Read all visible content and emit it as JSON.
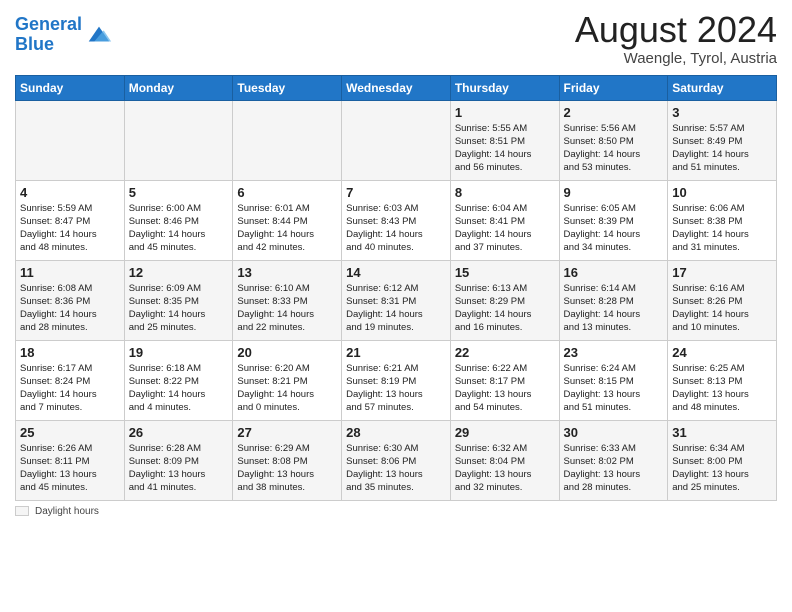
{
  "header": {
    "logo_line1": "General",
    "logo_line2": "Blue",
    "month_title": "August 2024",
    "location": "Waengle, Tyrol, Austria"
  },
  "legend": {
    "label": "Daylight hours"
  },
  "days_of_week": [
    "Sunday",
    "Monday",
    "Tuesday",
    "Wednesday",
    "Thursday",
    "Friday",
    "Saturday"
  ],
  "weeks": [
    [
      {
        "day": "",
        "info": ""
      },
      {
        "day": "",
        "info": ""
      },
      {
        "day": "",
        "info": ""
      },
      {
        "day": "",
        "info": ""
      },
      {
        "day": "1",
        "info": "Sunrise: 5:55 AM\nSunset: 8:51 PM\nDaylight: 14 hours\nand 56 minutes."
      },
      {
        "day": "2",
        "info": "Sunrise: 5:56 AM\nSunset: 8:50 PM\nDaylight: 14 hours\nand 53 minutes."
      },
      {
        "day": "3",
        "info": "Sunrise: 5:57 AM\nSunset: 8:49 PM\nDaylight: 14 hours\nand 51 minutes."
      }
    ],
    [
      {
        "day": "4",
        "info": "Sunrise: 5:59 AM\nSunset: 8:47 PM\nDaylight: 14 hours\nand 48 minutes."
      },
      {
        "day": "5",
        "info": "Sunrise: 6:00 AM\nSunset: 8:46 PM\nDaylight: 14 hours\nand 45 minutes."
      },
      {
        "day": "6",
        "info": "Sunrise: 6:01 AM\nSunset: 8:44 PM\nDaylight: 14 hours\nand 42 minutes."
      },
      {
        "day": "7",
        "info": "Sunrise: 6:03 AM\nSunset: 8:43 PM\nDaylight: 14 hours\nand 40 minutes."
      },
      {
        "day": "8",
        "info": "Sunrise: 6:04 AM\nSunset: 8:41 PM\nDaylight: 14 hours\nand 37 minutes."
      },
      {
        "day": "9",
        "info": "Sunrise: 6:05 AM\nSunset: 8:39 PM\nDaylight: 14 hours\nand 34 minutes."
      },
      {
        "day": "10",
        "info": "Sunrise: 6:06 AM\nSunset: 8:38 PM\nDaylight: 14 hours\nand 31 minutes."
      }
    ],
    [
      {
        "day": "11",
        "info": "Sunrise: 6:08 AM\nSunset: 8:36 PM\nDaylight: 14 hours\nand 28 minutes."
      },
      {
        "day": "12",
        "info": "Sunrise: 6:09 AM\nSunset: 8:35 PM\nDaylight: 14 hours\nand 25 minutes."
      },
      {
        "day": "13",
        "info": "Sunrise: 6:10 AM\nSunset: 8:33 PM\nDaylight: 14 hours\nand 22 minutes."
      },
      {
        "day": "14",
        "info": "Sunrise: 6:12 AM\nSunset: 8:31 PM\nDaylight: 14 hours\nand 19 minutes."
      },
      {
        "day": "15",
        "info": "Sunrise: 6:13 AM\nSunset: 8:29 PM\nDaylight: 14 hours\nand 16 minutes."
      },
      {
        "day": "16",
        "info": "Sunrise: 6:14 AM\nSunset: 8:28 PM\nDaylight: 14 hours\nand 13 minutes."
      },
      {
        "day": "17",
        "info": "Sunrise: 6:16 AM\nSunset: 8:26 PM\nDaylight: 14 hours\nand 10 minutes."
      }
    ],
    [
      {
        "day": "18",
        "info": "Sunrise: 6:17 AM\nSunset: 8:24 PM\nDaylight: 14 hours\nand 7 minutes."
      },
      {
        "day": "19",
        "info": "Sunrise: 6:18 AM\nSunset: 8:22 PM\nDaylight: 14 hours\nand 4 minutes."
      },
      {
        "day": "20",
        "info": "Sunrise: 6:20 AM\nSunset: 8:21 PM\nDaylight: 14 hours\nand 0 minutes."
      },
      {
        "day": "21",
        "info": "Sunrise: 6:21 AM\nSunset: 8:19 PM\nDaylight: 13 hours\nand 57 minutes."
      },
      {
        "day": "22",
        "info": "Sunrise: 6:22 AM\nSunset: 8:17 PM\nDaylight: 13 hours\nand 54 minutes."
      },
      {
        "day": "23",
        "info": "Sunrise: 6:24 AM\nSunset: 8:15 PM\nDaylight: 13 hours\nand 51 minutes."
      },
      {
        "day": "24",
        "info": "Sunrise: 6:25 AM\nSunset: 8:13 PM\nDaylight: 13 hours\nand 48 minutes."
      }
    ],
    [
      {
        "day": "25",
        "info": "Sunrise: 6:26 AM\nSunset: 8:11 PM\nDaylight: 13 hours\nand 45 minutes."
      },
      {
        "day": "26",
        "info": "Sunrise: 6:28 AM\nSunset: 8:09 PM\nDaylight: 13 hours\nand 41 minutes."
      },
      {
        "day": "27",
        "info": "Sunrise: 6:29 AM\nSunset: 8:08 PM\nDaylight: 13 hours\nand 38 minutes."
      },
      {
        "day": "28",
        "info": "Sunrise: 6:30 AM\nSunset: 8:06 PM\nDaylight: 13 hours\nand 35 minutes."
      },
      {
        "day": "29",
        "info": "Sunrise: 6:32 AM\nSunset: 8:04 PM\nDaylight: 13 hours\nand 32 minutes."
      },
      {
        "day": "30",
        "info": "Sunrise: 6:33 AM\nSunset: 8:02 PM\nDaylight: 13 hours\nand 28 minutes."
      },
      {
        "day": "31",
        "info": "Sunrise: 6:34 AM\nSunset: 8:00 PM\nDaylight: 13 hours\nand 25 minutes."
      }
    ]
  ]
}
